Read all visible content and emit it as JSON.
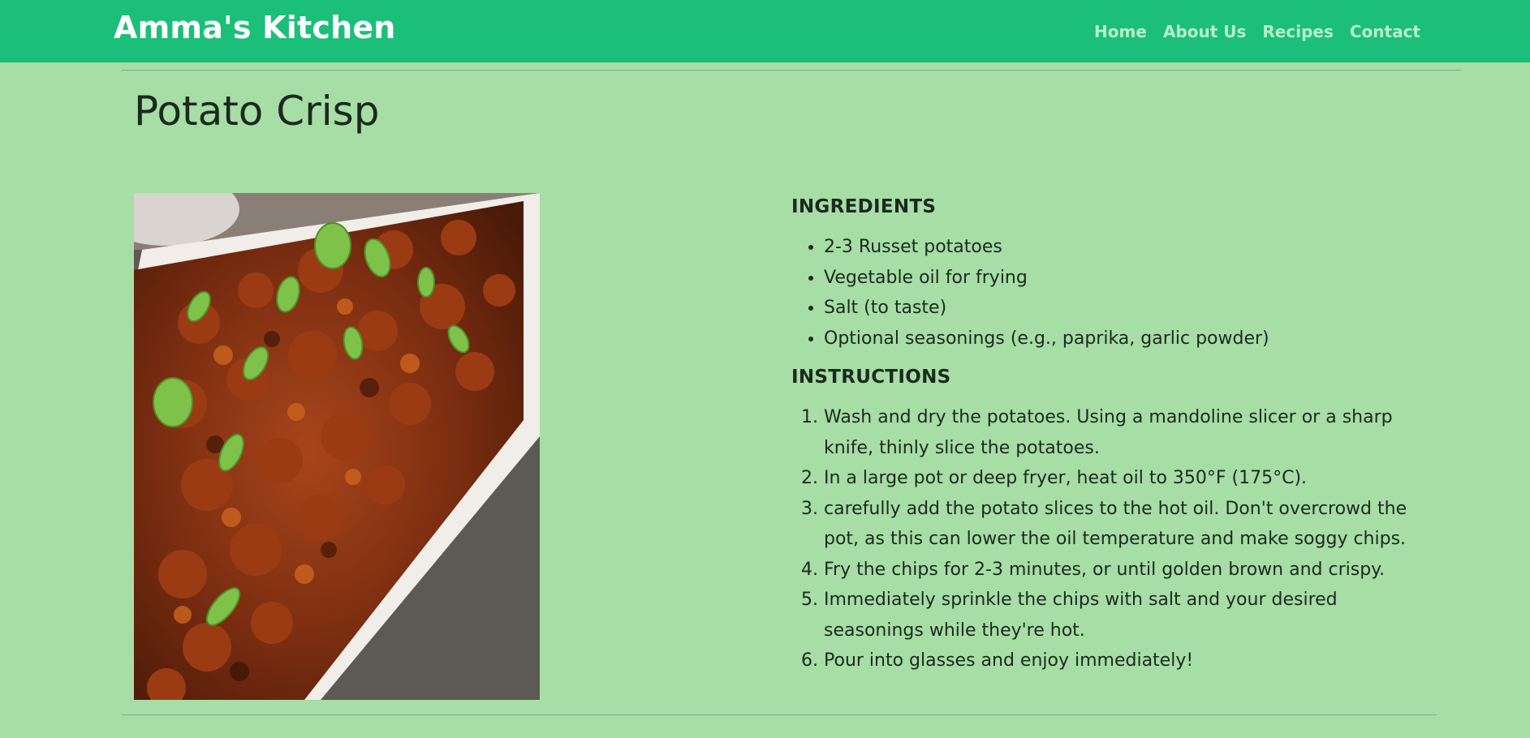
{
  "header": {
    "brand": "Amma's Kitchen",
    "nav": [
      "Home",
      "About Us",
      "Recipes",
      "Contact"
    ]
  },
  "page": {
    "title": "Potato Crisp"
  },
  "recipe": {
    "ingredients_heading": "INGREDIENTS",
    "ingredients": [
      "2-3 Russet potatoes",
      "Vegetable oil for frying",
      "Salt (to taste)",
      "Optional seasonings (e.g., paprika, garlic powder)"
    ],
    "instructions_heading": "INSTRUCTIONS",
    "instructions": [
      "Wash and dry the potatoes. Using a mandoline slicer or a sharp knife, thinly slice the potatoes.",
      "In a large pot or deep fryer, heat oil to 350°F (175°C).",
      "carefully add the potato slices to the hot oil. Don't overcrowd the pot, as this can lower the oil temperature and make soggy chips.",
      "Fry the chips for 2-3 minutes, or until golden brown and crispy.",
      "Immediately sprinkle the chips with salt and your desired seasonings while they're hot.",
      "Pour into glasses and enjoy immediately!"
    ]
  },
  "colors": {
    "navbar": "#1bbf7a",
    "page_background": "#a6dea6",
    "brand_text": "#ffffff",
    "nav_link": "#b8f0c8"
  }
}
